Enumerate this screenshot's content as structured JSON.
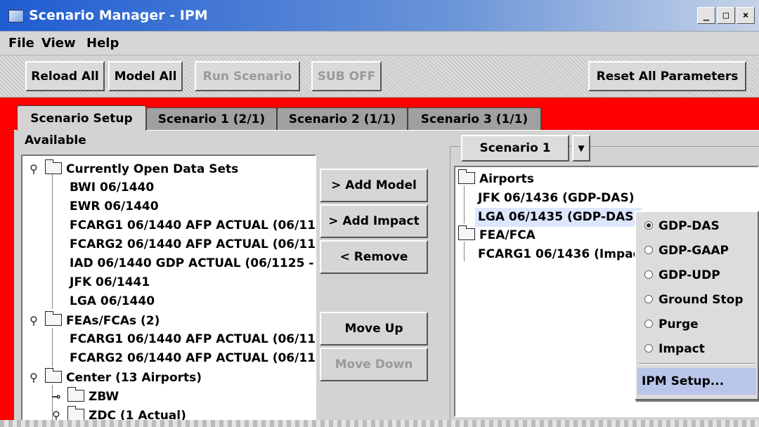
{
  "window": {
    "title": "Scenario Manager - IPM",
    "controls": [
      "_",
      "□",
      "×"
    ]
  },
  "menu": [
    "File",
    "View",
    "Help"
  ],
  "toolbar": {
    "reload_all": "Reload All",
    "model_all": "Model All",
    "run_scenario": "Run Scenario",
    "sub_off": "SUB OFF",
    "reset_all": "Reset All Parameters"
  },
  "tabs": [
    "Scenario Setup",
    "Scenario 1 (2/1)",
    "Scenario 2 (1/1)",
    "Scenario 3 (1/1)"
  ],
  "available": {
    "label": "Available",
    "tree": [
      {
        "text": "Currently Open Data Sets",
        "type": "folder",
        "toggle": "⚲"
      },
      {
        "text": "BWI 06/1440",
        "type": "leaf"
      },
      {
        "text": "EWR 06/1440",
        "type": "leaf"
      },
      {
        "text": "FCARG1 06/1440 AFP ACTUAL (06/11",
        "type": "leaf"
      },
      {
        "text": "FCARG2 06/1440 AFP ACTUAL (06/11",
        "type": "leaf"
      },
      {
        "text": "IAD 06/1440 GDP ACTUAL (06/1125 -",
        "type": "leaf"
      },
      {
        "text": "JFK 06/1441",
        "type": "leaf"
      },
      {
        "text": "LGA 06/1440",
        "type": "leaf"
      },
      {
        "text": "FEAs/FCAs (2)",
        "type": "folder"
      },
      {
        "text": "FCARG1 06/1440 AFP ACTUAL (06/11",
        "type": "leaf"
      },
      {
        "text": "FCARG2 06/1440 AFP ACTUAL (06/11",
        "type": "leaf"
      },
      {
        "text": "Center (13 Airports)",
        "type": "folder"
      },
      {
        "text": "ZBW",
        "type": "subfolder"
      },
      {
        "text": "ZDC (1 Actual)",
        "type": "subfolder"
      }
    ]
  },
  "actions": {
    "add_model": "> Add Model",
    "add_impact": "> Add Impact",
    "remove": "< Remove",
    "move_up": "Move Up",
    "move_down": "Move Down"
  },
  "scenario_combo": {
    "value": "Scenario 1"
  },
  "scenario_tree": [
    {
      "text": "Airports",
      "type": "folder"
    },
    {
      "text": "JFK 06/1436 (GDP-DAS)",
      "type": "leaf"
    },
    {
      "text": "LGA 06/1435 (GDP-DAS)",
      "type": "leaf",
      "selected": true
    },
    {
      "text": "FEA/FCA",
      "type": "folder"
    },
    {
      "text": "FCARG1 06/1436 (Impac",
      "type": "leaf"
    }
  ],
  "context_menu": {
    "options": [
      {
        "label": "GDP-DAS",
        "selected": true
      },
      {
        "label": "GDP-GAAP",
        "selected": false
      },
      {
        "label": "GDP-UDP",
        "selected": false
      },
      {
        "label": "Ground Stop",
        "selected": false
      },
      {
        "label": "Purge",
        "selected": false
      },
      {
        "label": "Impact",
        "selected": false
      }
    ],
    "setup": "IPM Setup..."
  },
  "colors": {
    "accent": "#ff0000",
    "titlebar": "#1f5cd1",
    "highlight": "#b9c6ea"
  }
}
